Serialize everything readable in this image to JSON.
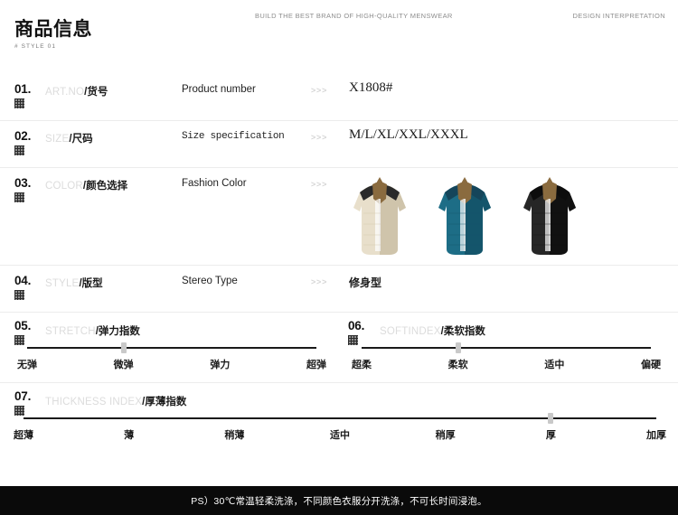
{
  "header": {
    "tagline": "BUILD THE BEST BRAND OF HIGH-QUALITY MENSWEAR",
    "right_label": "DESIGN INTERPRETATION"
  },
  "title": {
    "main": "商品信息",
    "subtitle": "# STYLE 01"
  },
  "chevron": ">>>",
  "rows": [
    {
      "index": "01.",
      "label_en": "ART.NO",
      "label_cn": "/货号",
      "description": "Product number",
      "value": "X1808#"
    },
    {
      "index": "02.",
      "label_en": "SIZE",
      "label_cn": "/尺码",
      "description": "Size specification",
      "value": "M/L/XL/XXL/XXXL"
    },
    {
      "index": "03.",
      "label_en": "COLOR",
      "label_cn": "/颜色选择",
      "description": "Fashion Color",
      "value": ""
    },
    {
      "index": "04.",
      "label_en": "STYLE",
      "label_cn": "/版型",
      "description": "Stereo Type",
      "value": "修身型"
    }
  ],
  "colors": [
    {
      "name": "beige-jacket",
      "body": "#e8dfcb",
      "shade": "#cfc4ab",
      "collar": "#8a6b3f",
      "shoulder": "#2a2a2a"
    },
    {
      "name": "teal-jacket",
      "body": "#1d6d86",
      "shade": "#14556b",
      "collar": "#8a6b3f",
      "shoulder": "#15455a"
    },
    {
      "name": "black-jacket",
      "body": "#262626",
      "shade": "#111111",
      "collar": "#8a6b3f",
      "shoulder": "#0d0d0d"
    }
  ],
  "indices": [
    {
      "index": "05.",
      "label_en": "STRETCH",
      "label_cn": "/弹力指数",
      "ticks": [
        "无弹",
        "微弹",
        "弹力",
        "超弹"
      ],
      "selected": 1
    },
    {
      "index": "06.",
      "label_en": "SOFTINDEX",
      "label_cn": "/柔软指数",
      "ticks": [
        "超柔",
        "柔软",
        "适中",
        "偏硬"
      ],
      "selected": 1
    },
    {
      "index": "07.",
      "label_en": "THICKNESS INDEX",
      "label_cn": "/厚薄指数",
      "ticks": [
        "超薄",
        "薄",
        "稍薄",
        "适中",
        "稍厚",
        "厚",
        "加厚"
      ],
      "selected": 5
    }
  ],
  "footer": {
    "note": "PS）30℃常温轻柔洗涤，不同颜色衣服分开洗涤，不可长时间浸泡。"
  }
}
